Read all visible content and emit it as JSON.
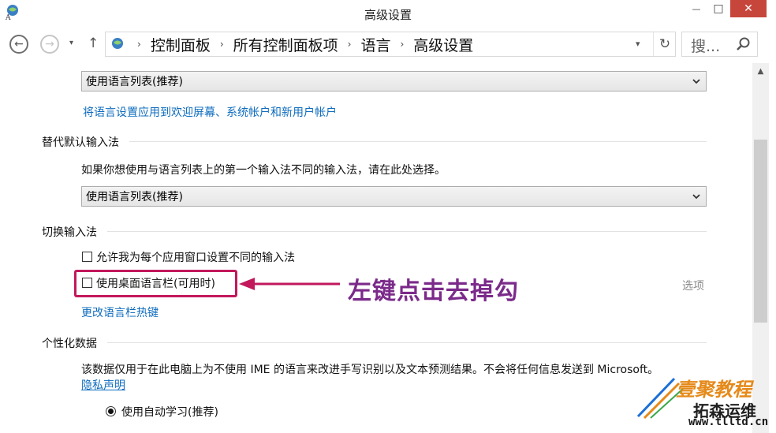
{
  "window": {
    "title": "高级设置",
    "close_glyph": "✕",
    "minimize_glyph": "—",
    "maximize_glyph": "□"
  },
  "nav": {
    "back_glyph": "←",
    "forward_glyph": "→",
    "dropdown_glyph": "▾",
    "up_glyph": "↑",
    "breadcrumbs": [
      "控制面板",
      "所有控制面板项",
      "语言",
      "高级设置"
    ],
    "breadcrumb_separator": "›",
    "refresh_glyph": "↻",
    "search_placeholder": "搜..."
  },
  "content": {
    "override_display_language": {
      "select_value": "使用语言列表(推荐)",
      "apply_link": "将语言设置应用到欢迎屏幕、系统帐户和新用户帐户"
    },
    "override_input_method": {
      "heading": "替代默认输入法",
      "description": "如果你想使用与语言列表上的第一个输入法不同的输入法，请在此处选择。",
      "select_value": "使用语言列表(推荐)"
    },
    "switch_input_methods": {
      "heading": "切换输入法",
      "per_app_checkbox_label": "允许我为每个应用窗口设置不同的输入法",
      "per_app_checked": false,
      "desktop_bar_checkbox_label": "使用桌面语言栏(可用时)",
      "desktop_bar_checked": false,
      "options_link": "选项",
      "hotkeys_link": "更改语言栏热键"
    },
    "personalization": {
      "heading": "个性化数据",
      "description": "该数据仅用于在此电脑上为不使用 IME 的语言来改进手写识别以及文本预测结果。不会将任何信息发送到 Microsoft。",
      "privacy_link": "隐私声明",
      "radio_label": "使用自动学习(推荐)",
      "radio_selected": true
    }
  },
  "annotation": {
    "text": "左键点击去掉勾",
    "color": "#c2185b"
  },
  "watermark": {
    "line1": "壹聚教程",
    "line2": "拓森运维",
    "url": "www.tlltd.cn"
  },
  "colors": {
    "link": "#0e6cbe",
    "close_button": "#c7463b",
    "annotation_text": "#7b2a8a"
  }
}
